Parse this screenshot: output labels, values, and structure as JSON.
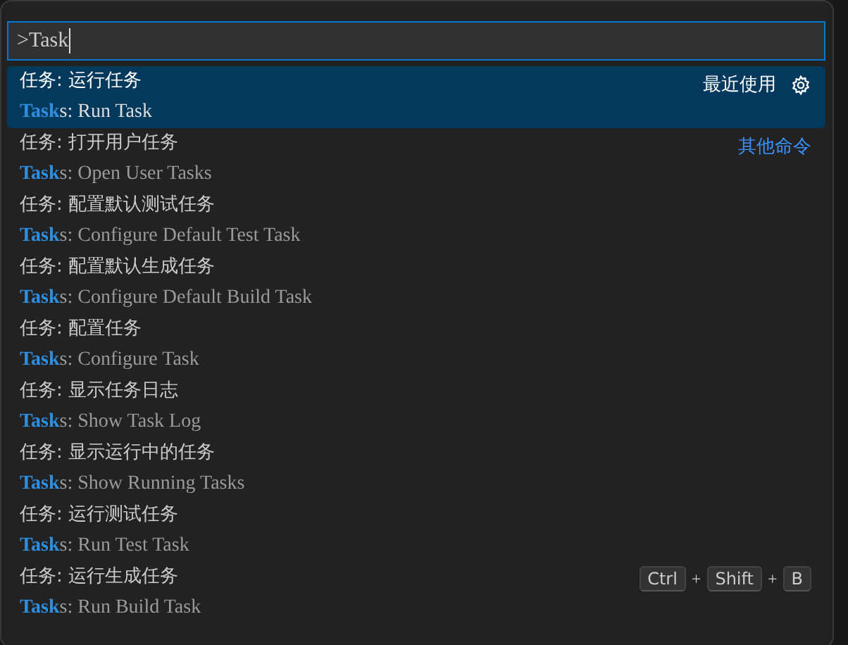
{
  "input": {
    "value": ">Task"
  },
  "items": [
    {
      "title": "任务: 运行任务",
      "subtitle": "**Task**s: Run Task",
      "selected": true,
      "right": {
        "kind": "recent",
        "label": "最近使用"
      }
    },
    {
      "title": "任务: 打开用户任务",
      "subtitle": "**Task**s: Open User Tasks",
      "selected": false,
      "right": {
        "kind": "link",
        "label": "其他命令"
      }
    },
    {
      "title": "任务: 配置默认测试任务",
      "subtitle": "**Task**s: Configure Default Test Task",
      "selected": false
    },
    {
      "title": "任务: 配置默认生成任务",
      "subtitle": "**Task**s: Configure Default Build Task",
      "selected": false
    },
    {
      "title": "任务: 配置任务",
      "subtitle": "**Task**s: Configure Task",
      "selected": false
    },
    {
      "title": "任务: 显示任务日志",
      "subtitle": "**Task**s: Show Task Log",
      "selected": false
    },
    {
      "title": "任务: 显示运行中的任务",
      "subtitle": "**Task**s: Show Running Tasks",
      "selected": false
    },
    {
      "title": "任务: 运行测试任务",
      "subtitle": "**Task**s: Run Test Task",
      "selected": false
    },
    {
      "title": "任务: 运行生成任务",
      "subtitle": "**Task**s: Run Build Task",
      "selected": false,
      "right": {
        "kind": "keys",
        "keys": [
          "Ctrl",
          "Shift",
          "B"
        ],
        "separator": "+"
      }
    }
  ]
}
